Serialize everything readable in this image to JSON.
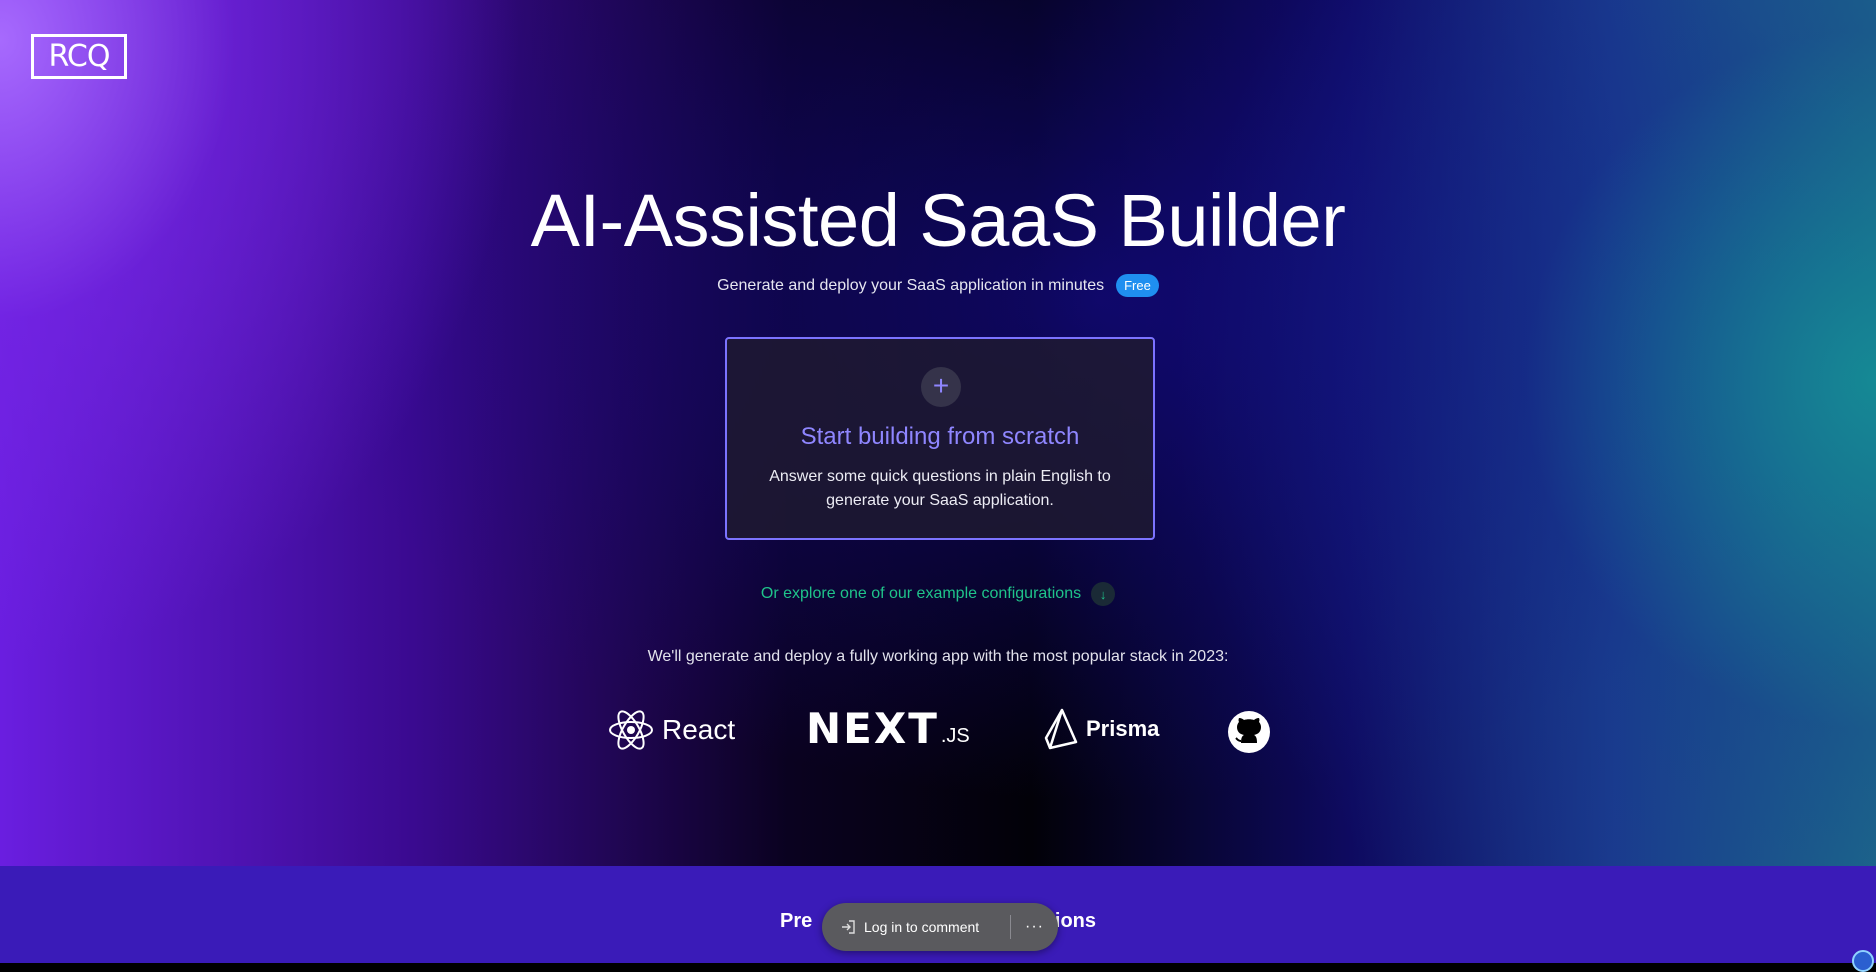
{
  "brand": {
    "logo_text": "RCQ"
  },
  "hero": {
    "title": "AI-Assisted SaaS Builder",
    "subtitle": "Generate and deploy your SaaS application in minutes",
    "badge": "Free"
  },
  "card": {
    "icon": "plus-icon",
    "title": "Start building from scratch",
    "description": "Answer some quick questions in plain English to generate your SaaS application."
  },
  "explore": {
    "label": "Or explore one of our example configurations",
    "icon": "arrow-down-icon"
  },
  "stack": {
    "text": "We'll generate and deploy a fully working app with the most popular stack in 2023:",
    "react_label": "React",
    "next_label": "NEXT",
    "next_suffix": ".JS",
    "prisma_label": "Prisma",
    "github_icon": "github-icon"
  },
  "bottom": {
    "heading_left": "Pre",
    "heading_right": "tions"
  },
  "comment_bar": {
    "login_label": "Log in to comment",
    "more_label": "···"
  },
  "colors": {
    "accent": "#8f86ff",
    "badge": "#1f8ff0",
    "explore": "#1fc38a",
    "bottom_band": "#3a1bb8"
  }
}
